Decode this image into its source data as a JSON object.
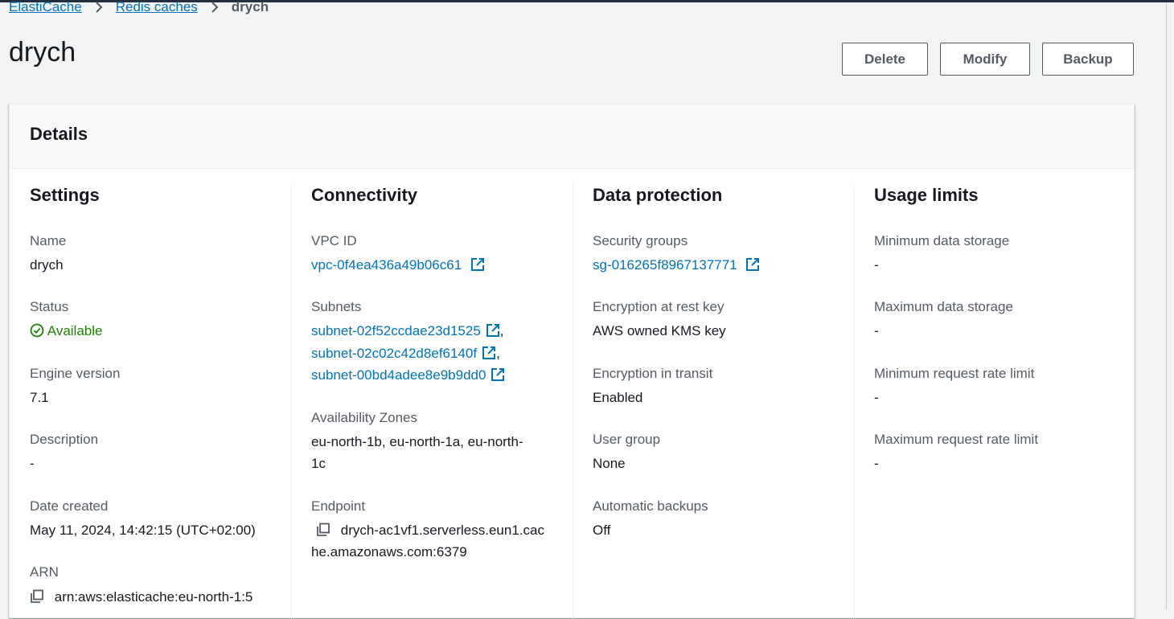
{
  "breadcrumb": {
    "items": [
      "ElastiCache",
      "Redis caches"
    ],
    "current": "drych"
  },
  "page": {
    "title": "drych"
  },
  "actions": {
    "delete": "Delete",
    "modify": "Modify",
    "backup": "Backup"
  },
  "details": {
    "title": "Details",
    "settings": {
      "title": "Settings",
      "name_label": "Name",
      "name_value": "drych",
      "status_label": "Status",
      "status_value": "Available",
      "engine_label": "Engine version",
      "engine_value": "7.1",
      "description_label": "Description",
      "description_value": "-",
      "date_label": "Date created",
      "date_value": "May 11, 2024, 14:42:15 (UTC+02:00)",
      "arn_label": "ARN",
      "arn_value": "arn:aws:elasticache:eu-north-1:5"
    },
    "connectivity": {
      "title": "Connectivity",
      "vpc_label": "VPC ID",
      "vpc_value": "vpc-0f4ea436a49b06c61",
      "subnets_label": "Subnets",
      "subnets": [
        "subnet-02f52ccdae23d1525",
        "subnet-02c02c42d8ef6140f",
        "subnet-00bd4adee8e9b9dd0"
      ],
      "subnet_sep": ",",
      "az_label": "Availability Zones",
      "az_line1": "eu-north-1b, eu-north-1a, eu-north-",
      "az_line2": "1c",
      "endpoint_label": "Endpoint",
      "endpoint_line1": "drych-ac1vf1.serverless.eun1.cac",
      "endpoint_line2": "he.amazonaws.com:6379"
    },
    "data_protection": {
      "title": "Data protection",
      "sg_label": "Security groups",
      "sg_value": "sg-016265f8967137771",
      "enc_rest_label": "Encryption at rest key",
      "enc_rest_value": "AWS owned KMS key",
      "enc_transit_label": "Encryption in transit",
      "enc_transit_value": "Enabled",
      "user_group_label": "User group",
      "user_group_value": "None",
      "backups_label": "Automatic backups",
      "backups_value": "Off"
    },
    "usage_limits": {
      "title": "Usage limits",
      "min_storage_label": "Minimum data storage",
      "min_storage_value": "-",
      "max_storage_label": "Maximum data storage",
      "max_storage_value": "-",
      "min_rate_label": "Minimum request rate limit",
      "min_rate_value": "-",
      "max_rate_label": "Maximum request rate limit",
      "max_rate_value": "-"
    }
  },
  "colors": {
    "link": "#0073bb",
    "success": "#1d8102",
    "header_bar": "#232f3e"
  },
  "icons": {
    "external": "external-link-icon",
    "copy": "copy-icon",
    "status": "check-circle-icon",
    "separator": "chevron-right-icon"
  }
}
